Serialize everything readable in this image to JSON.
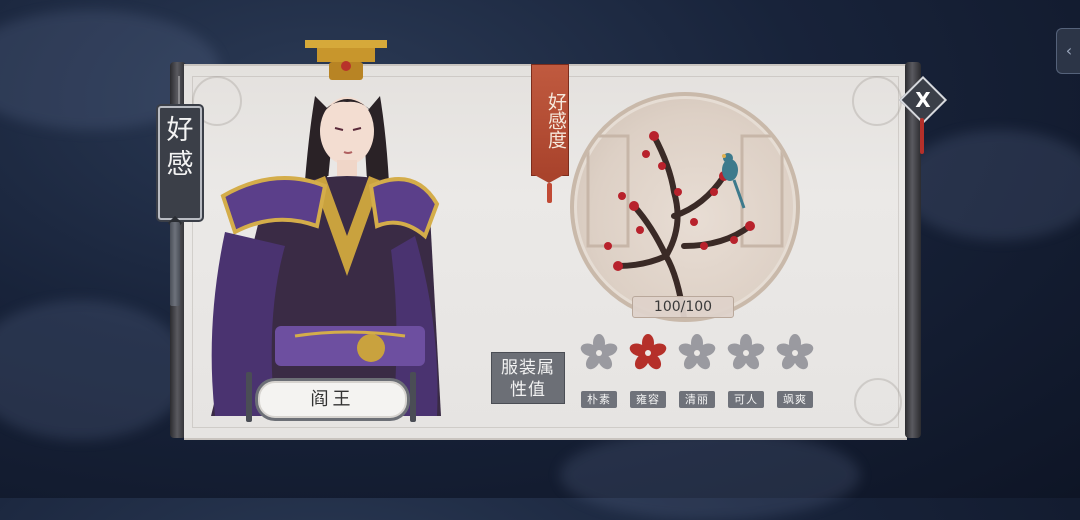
{
  "nav": {
    "side_tab_icon": "chevron-left-icon",
    "side_tab_glyph": "‹"
  },
  "tag": {
    "label": "好感"
  },
  "character": {
    "name": "阎王"
  },
  "favor": {
    "banner_label": "好感度",
    "value_text": "100/100",
    "value": 100,
    "max": 100
  },
  "attributes": {
    "button_label": "服装属性值",
    "items": [
      {
        "label": "朴素",
        "active": false
      },
      {
        "label": "雍容",
        "active": true
      },
      {
        "label": "清丽",
        "active": false
      },
      {
        "label": "可人",
        "active": false
      },
      {
        "label": "飒爽",
        "active": false
      }
    ]
  },
  "close": {
    "glyph": "X"
  },
  "colors": {
    "accent_red": "#b5302a",
    "banner_red": "#b0492f",
    "parchment": "#e7e4e1",
    "chip_gray": "#6f727a",
    "flower_gray": "#9a9aa0"
  }
}
